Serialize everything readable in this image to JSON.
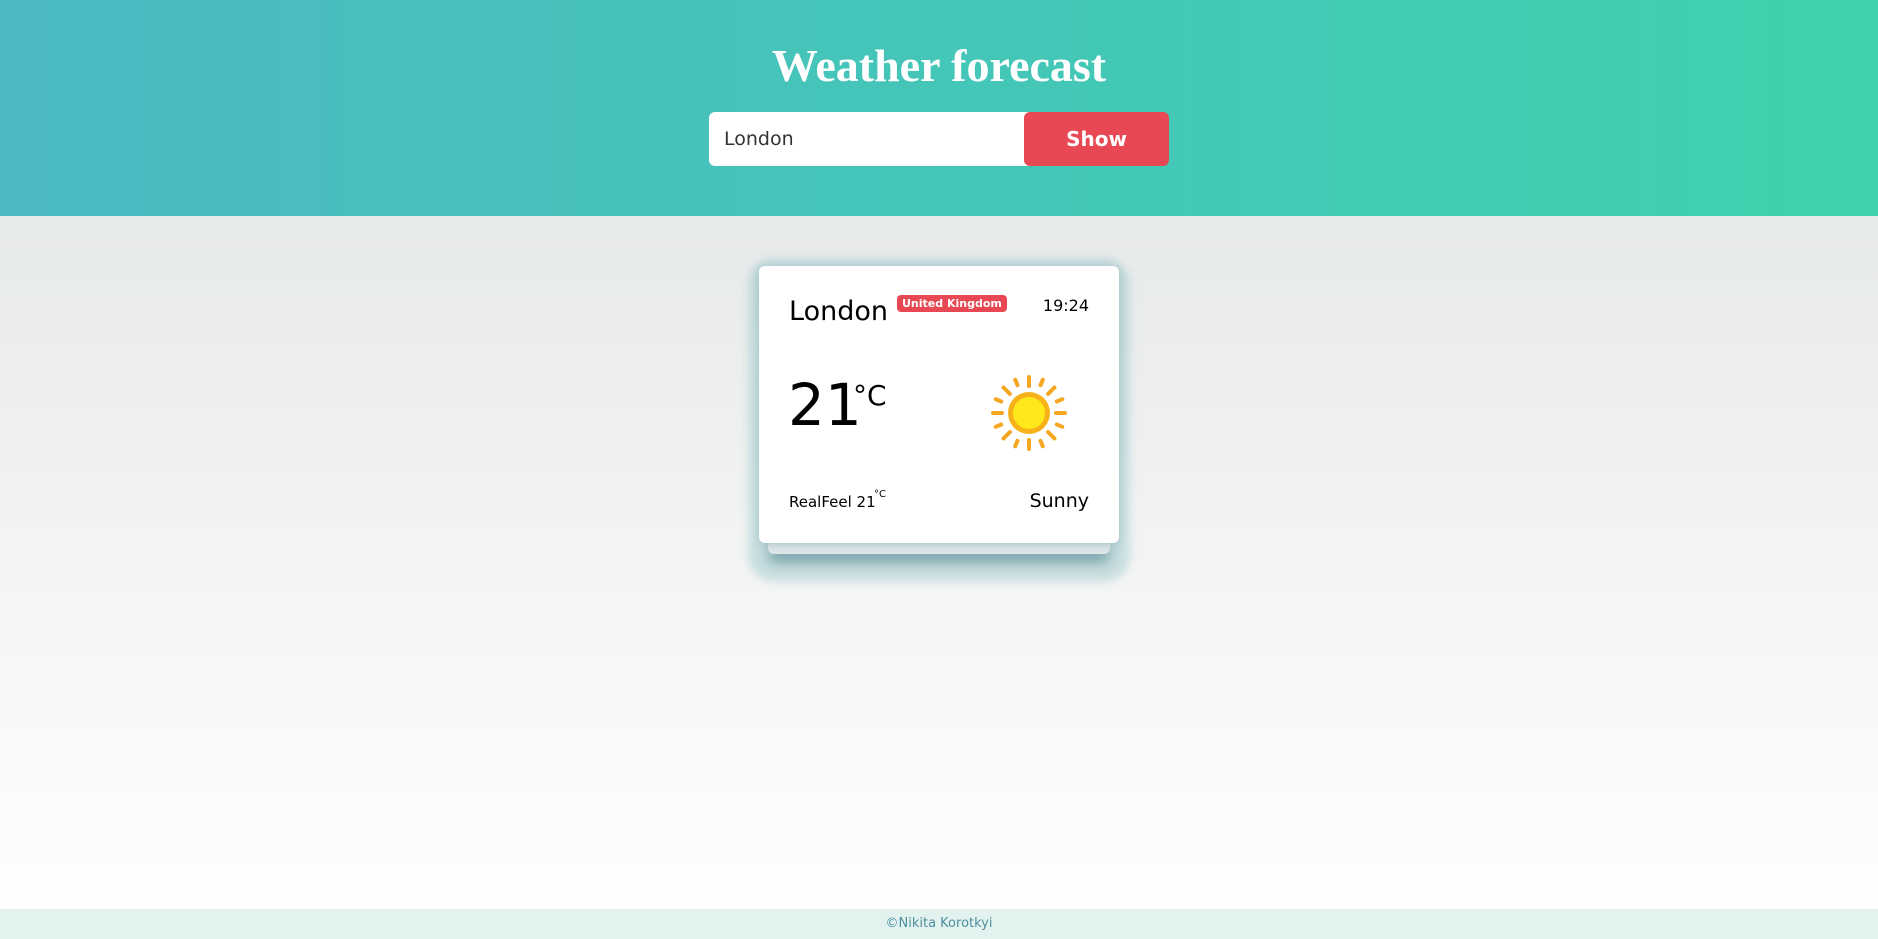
{
  "header": {
    "title": "Weather forecast",
    "search_value": "London",
    "show_label": "Show"
  },
  "card": {
    "city": "London",
    "country": "United Kingdom",
    "time": "19:24",
    "temperature": "21",
    "temperature_unit": "°C",
    "realfeel_label": "RealFeel 21",
    "realfeel_unit": "°C",
    "condition": "Sunny",
    "icon": "sun-icon"
  },
  "footer": {
    "text": "©Nikita Korotkyi"
  },
  "colors": {
    "header_start": "#4bb9c3",
    "header_end": "#3ed2ad",
    "accent_red": "#e84853",
    "footer_bg": "#e2f3ef"
  }
}
